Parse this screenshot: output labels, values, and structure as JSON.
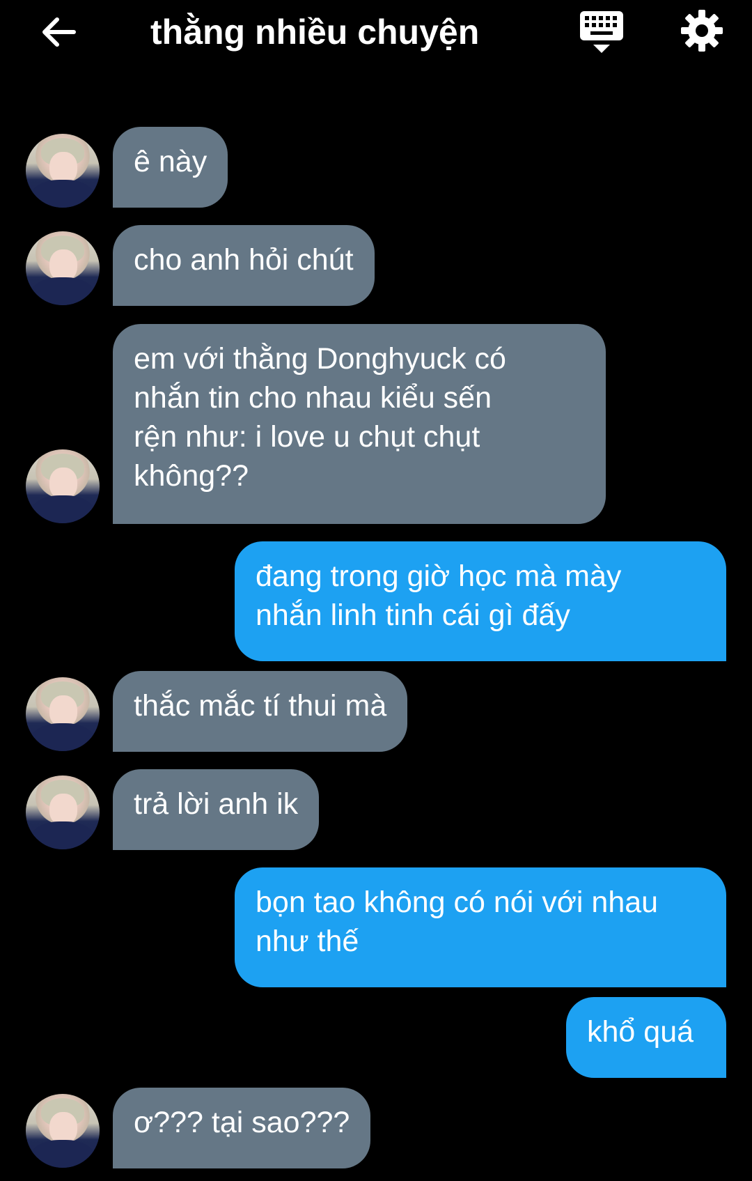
{
  "header": {
    "title": "thằng nhiều chuyện",
    "back_icon": "arrow-left-icon",
    "keyboard_icon": "keyboard-icon",
    "settings_icon": "gear-icon"
  },
  "colors": {
    "background": "#000000",
    "incoming_bubble": "#657786",
    "outgoing_bubble": "#1da1f2",
    "text": "#ffffff"
  },
  "messages": [
    {
      "direction": "in",
      "text": "ê này"
    },
    {
      "direction": "in",
      "text": "cho anh hỏi chút"
    },
    {
      "direction": "in",
      "text": "em với thằng Donghyuck có\nnhắn tin cho nhau kiểu sến\nrện như: i love u chụt chụt\nkhông??"
    },
    {
      "direction": "out",
      "text": "đang trong giờ học mà mày\nnhắn linh tinh cái gì đấy"
    },
    {
      "direction": "in",
      "text": "thắc mắc tí thui mà"
    },
    {
      "direction": "in",
      "text": "trả lời anh ik"
    },
    {
      "direction": "out",
      "text": "bọn tao không có nói với nhau\nnhư thế"
    },
    {
      "direction": "out",
      "text": "khổ quá"
    },
    {
      "direction": "in",
      "text": "ơ??? tại sao???"
    }
  ]
}
